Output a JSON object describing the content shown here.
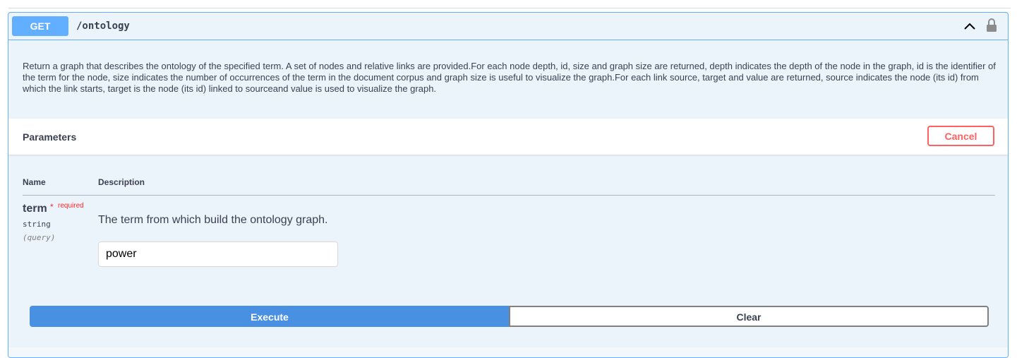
{
  "operation": {
    "method": "GET",
    "path": "/ontology",
    "description": "Return a graph that describes the ontology of the specified term. A set of nodes and relative links are provided.For each node depth, id, size and graph size are returned, depth indicates the depth of the node in the graph, id is the identifier of the term for the node, size indicates the number of occurrences of the term in the document corpus and graph size is useful to visualize the graph.For each link source, target and value are returned, source indicates the node (its id) from which the link starts, target is the node (its id) linked to sourceand value is used to visualize the graph."
  },
  "parameters": {
    "title": "Parameters",
    "cancel_label": "Cancel",
    "columns": {
      "name": "Name",
      "description": "Description"
    },
    "items": [
      {
        "name": "term",
        "required_star": "*",
        "required_label": "required",
        "type": "string",
        "in": "(query)",
        "description": "The term from which build the ontology graph.",
        "value": "power"
      }
    ]
  },
  "actions": {
    "execute_label": "Execute",
    "clear_label": "Clear"
  },
  "colors": {
    "method_get": "#61affe",
    "execute": "#4990e2",
    "cancel": "#ff6060",
    "required": "#ff2a2a"
  },
  "icons": {
    "collapse": "chevron-up-icon",
    "auth": "lock-icon"
  }
}
